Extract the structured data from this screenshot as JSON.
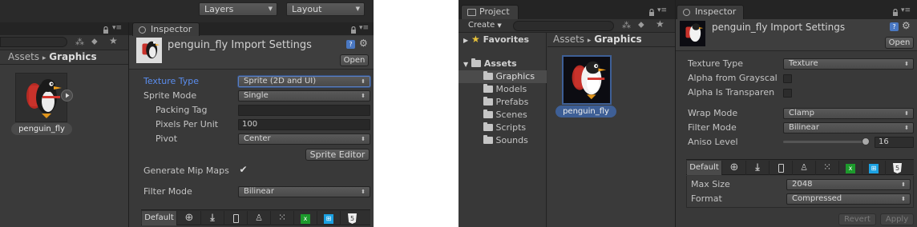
{
  "left": {
    "toolbar": {
      "layers_label": "Layers",
      "layout_label": "Layout"
    },
    "inspector_tab": "Inspector",
    "breadcrumb": {
      "root": "Assets",
      "separator": "▸",
      "current": "Graphics"
    },
    "asset": {
      "name": "penguin_fly"
    },
    "header": {
      "title": "penguin_fly Import Settings",
      "open_button": "Open"
    },
    "fields": {
      "texture_type": {
        "label": "Texture Type",
        "value": "Sprite (2D and UI)"
      },
      "sprite_mode": {
        "label": "Sprite Mode",
        "value": "Single"
      },
      "packing_tag": {
        "label": "Packing Tag",
        "value": ""
      },
      "pixels_per_unit": {
        "label": "Pixels Per Unit",
        "value": "100"
      },
      "pivot": {
        "label": "Pivot",
        "value": "Center"
      },
      "sprite_editor_button": "Sprite Editor",
      "generate_mip_maps": {
        "label": "Generate Mip Maps",
        "checked": true,
        "mark": "✔"
      },
      "filter_mode": {
        "label": "Filter Mode",
        "value": "Bilinear"
      }
    },
    "platform_default": "Default"
  },
  "right": {
    "project_tab": "Project",
    "inspector_tab": "Inspector",
    "create_label": "Create",
    "favorites_label": "Favorites",
    "assets_label": "Assets",
    "folders": [
      "Graphics",
      "Models",
      "Prefabs",
      "Scenes",
      "Scripts",
      "Sounds"
    ],
    "breadcrumb": {
      "root": "Assets",
      "separator": "▸",
      "current": "Graphics"
    },
    "asset": {
      "name": "penguin_fly"
    },
    "header": {
      "title": "penguin_fly Import Settings",
      "open_button": "Open"
    },
    "fields": {
      "texture_type": {
        "label": "Texture Type",
        "value": "Texture"
      },
      "alpha_from_grayscale": {
        "label": "Alpha from Grayscal",
        "checked": false
      },
      "alpha_is_transparency": {
        "label": "Alpha Is Transparen",
        "checked": false
      },
      "wrap_mode": {
        "label": "Wrap Mode",
        "value": "Clamp"
      },
      "filter_mode": {
        "label": "Filter Mode",
        "value": "Bilinear"
      },
      "aniso_level": {
        "label": "Aniso Level",
        "value": "16",
        "fraction": 1.0
      },
      "max_size": {
        "label": "Max Size",
        "value": "2048"
      },
      "format": {
        "label": "Format",
        "value": "Compressed"
      }
    },
    "platform_default": "Default",
    "revert_button": "Revert",
    "apply_button": "Apply"
  },
  "icons": [
    "globe-icon",
    "download-icon",
    "phone-icon",
    "android-icon",
    "blackberry-icon",
    "xbox-icon",
    "windows-store-icon",
    "html5-icon"
  ],
  "colors": {
    "panel_bg": "#383838",
    "tabbar_bg": "#242424",
    "highlight_label": "#5a8dee",
    "selection_bg": "#3e5f96",
    "xbox_green": "#1d9a2c",
    "windows_blue": "#1ba1e2"
  }
}
